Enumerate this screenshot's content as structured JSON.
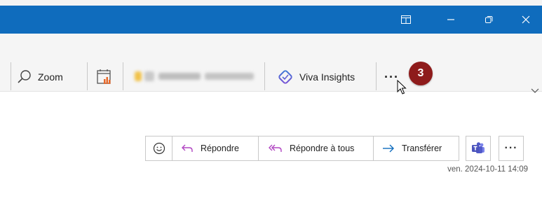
{
  "titlebar": {
    "bg_color": "#0f6cbd",
    "buttons": [
      {
        "name": "layout-icon"
      },
      {
        "name": "minimize-icon"
      },
      {
        "name": "restore-icon"
      },
      {
        "name": "close-icon"
      }
    ]
  },
  "ribbon": {
    "zoom_label": "Zoom",
    "viva_label": "Viva Insights",
    "more_label": "···",
    "step_badge": "3",
    "badge_color": "#8e1b1b"
  },
  "message_actions": {
    "reply_label": "Répondre",
    "reply_all_label": "Répondre à tous",
    "forward_label": "Transférer",
    "more_label": "···",
    "reply_color": "#b146c2",
    "forward_color": "#0f6cbd",
    "teams_color": "#5059c9"
  },
  "message": {
    "date": "ven. 2024-10-11 14:09"
  }
}
